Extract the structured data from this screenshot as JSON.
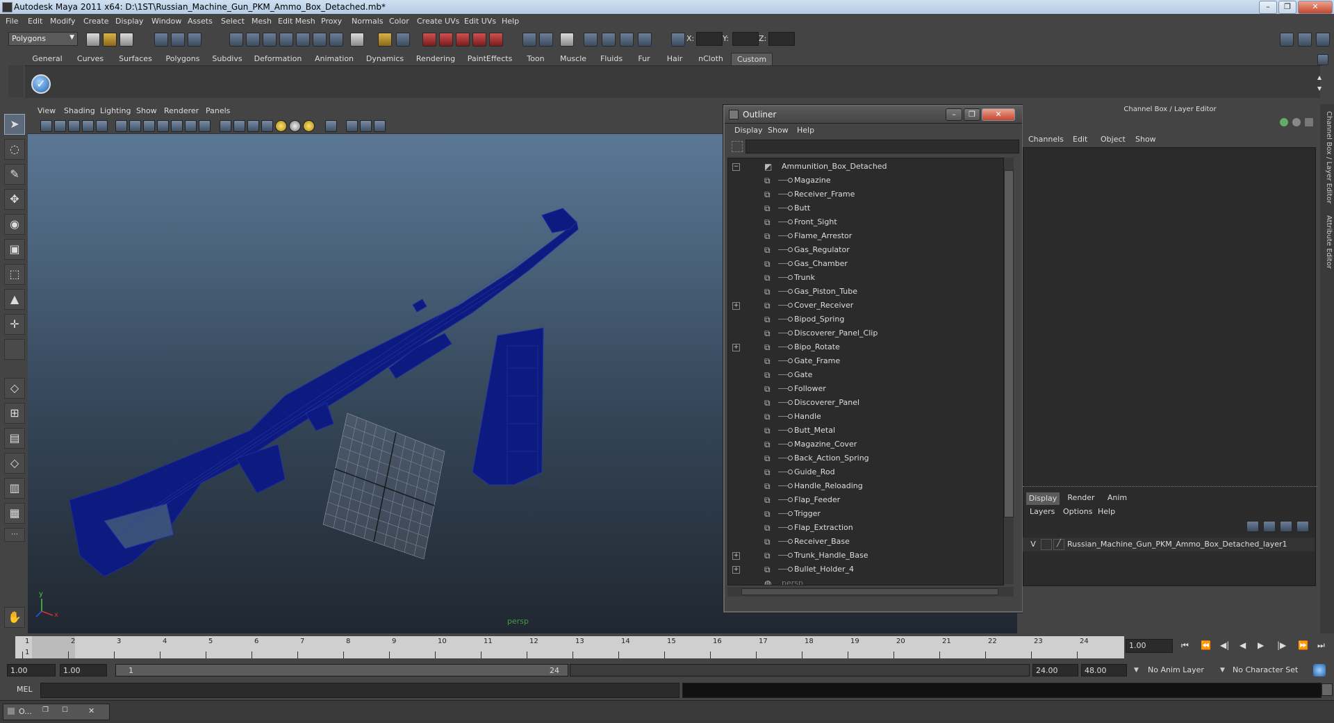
{
  "title_bar": {
    "title": "Autodesk Maya 2011 x64: D:\\1ST\\Russian_Machine_Gun_PKM_Ammo_Box_Detached.mb*"
  },
  "menu_bar": [
    "File",
    "Edit",
    "Modify",
    "Create",
    "Display",
    "Window",
    "Assets",
    "Select",
    "Mesh",
    "Edit Mesh",
    "Proxy",
    "Normals",
    "Color",
    "Create UVs",
    "Edit UVs",
    "Help"
  ],
  "status_line": {
    "mode": "Polygons",
    "x_label": "X:",
    "y_label": "Y:",
    "z_label": "Z:"
  },
  "shelf": {
    "tabs": [
      "General",
      "Curves",
      "Surfaces",
      "Polygons",
      "Subdivs",
      "Deformation",
      "Animation",
      "Dynamics",
      "Rendering",
      "PaintEffects",
      "Toon",
      "Muscle",
      "Fluids",
      "Fur",
      "Hair",
      "nCloth",
      "Custom"
    ],
    "active_tab": "Custom"
  },
  "viewport": {
    "menu": [
      "View",
      "Shading",
      "Lighting",
      "Show",
      "Renderer",
      "Panels"
    ],
    "camera_label": "persp",
    "axis_y": "y",
    "axis_x": "x"
  },
  "outliner": {
    "title": "Outliner",
    "menu": [
      "Display",
      "Show",
      "Help"
    ],
    "root": "Ammunition_Box_Detached",
    "items": [
      {
        "name": "Magazine",
        "expandable": false
      },
      {
        "name": "Receiver_Frame",
        "expandable": false
      },
      {
        "name": "Butt",
        "expandable": false
      },
      {
        "name": "Front_Sight",
        "expandable": false
      },
      {
        "name": "Flame_Arrestor",
        "expandable": false
      },
      {
        "name": "Gas_Regulator",
        "expandable": false
      },
      {
        "name": "Gas_Chamber",
        "expandable": false
      },
      {
        "name": "Trunk",
        "expandable": false
      },
      {
        "name": "Gas_Piston_Tube",
        "expandable": false
      },
      {
        "name": "Cover_Receiver",
        "expandable": true
      },
      {
        "name": "Bipod_Spring",
        "expandable": false
      },
      {
        "name": "Discoverer_Panel_Clip",
        "expandable": false
      },
      {
        "name": "Bipo_Rotate",
        "expandable": true
      },
      {
        "name": "Gate_Frame",
        "expandable": false
      },
      {
        "name": "Gate",
        "expandable": false
      },
      {
        "name": "Follower",
        "expandable": false
      },
      {
        "name": "Discoverer_Panel",
        "expandable": false
      },
      {
        "name": "Handle",
        "expandable": false
      },
      {
        "name": "Butt_Metal",
        "expandable": false
      },
      {
        "name": "Magazine_Cover",
        "expandable": false
      },
      {
        "name": "Back_Action_Spring",
        "expandable": false
      },
      {
        "name": "Guide_Rod",
        "expandable": false
      },
      {
        "name": "Handle_Reloading",
        "expandable": false
      },
      {
        "name": "Flap_Feeder",
        "expandable": false
      },
      {
        "name": "Trigger",
        "expandable": false
      },
      {
        "name": "Flap_Extraction",
        "expandable": false
      },
      {
        "name": "Receiver_Base",
        "expandable": false
      },
      {
        "name": "Trunk_Handle_Base",
        "expandable": true
      },
      {
        "name": "Bullet_Holder_4",
        "expandable": true
      }
    ],
    "camera": "persp"
  },
  "channel_box": {
    "title": "Channel Box / Layer Editor",
    "menu": [
      "Channels",
      "Edit",
      "Object",
      "Show"
    ],
    "layer_tabs": [
      "Display",
      "Render",
      "Anim"
    ],
    "active_layer_tab": "Display",
    "layer_menu": [
      "Layers",
      "Options",
      "Help"
    ],
    "layer": {
      "visibility": "V",
      "name": "Russian_Machine_Gun_PKM_Ammo_Box_Detached_layer1"
    },
    "side_tabs": [
      "Channel Box / Layer Editor",
      "Attribute Editor"
    ]
  },
  "time_slider": {
    "ticks": [
      "1",
      "2",
      "3",
      "4",
      "5",
      "6",
      "7",
      "8",
      "9",
      "10",
      "11",
      "12",
      "13",
      "14",
      "15",
      "16",
      "17",
      "18",
      "19",
      "20",
      "21",
      "22",
      "23",
      "24"
    ],
    "current_frame_label": "1",
    "current_frame": "1.00"
  },
  "range_slider": {
    "start_time": "1.00",
    "playback_start": "1.00",
    "range_start_label": "1",
    "range_end_label": "24",
    "playback_end": "24.00",
    "end_time": "48.00",
    "anim_layer": "No Anim Layer",
    "character_set": "No Character Set"
  },
  "command_line": {
    "label": "MEL"
  },
  "taskbar": {
    "item": "O..."
  },
  "colors": {
    "wireframe": "#0d1a80",
    "viewport_top": "#5f7d9c",
    "viewport_bottom": "#202730",
    "panel_bg": "#444444",
    "list_bg": "#2b2b2b"
  }
}
